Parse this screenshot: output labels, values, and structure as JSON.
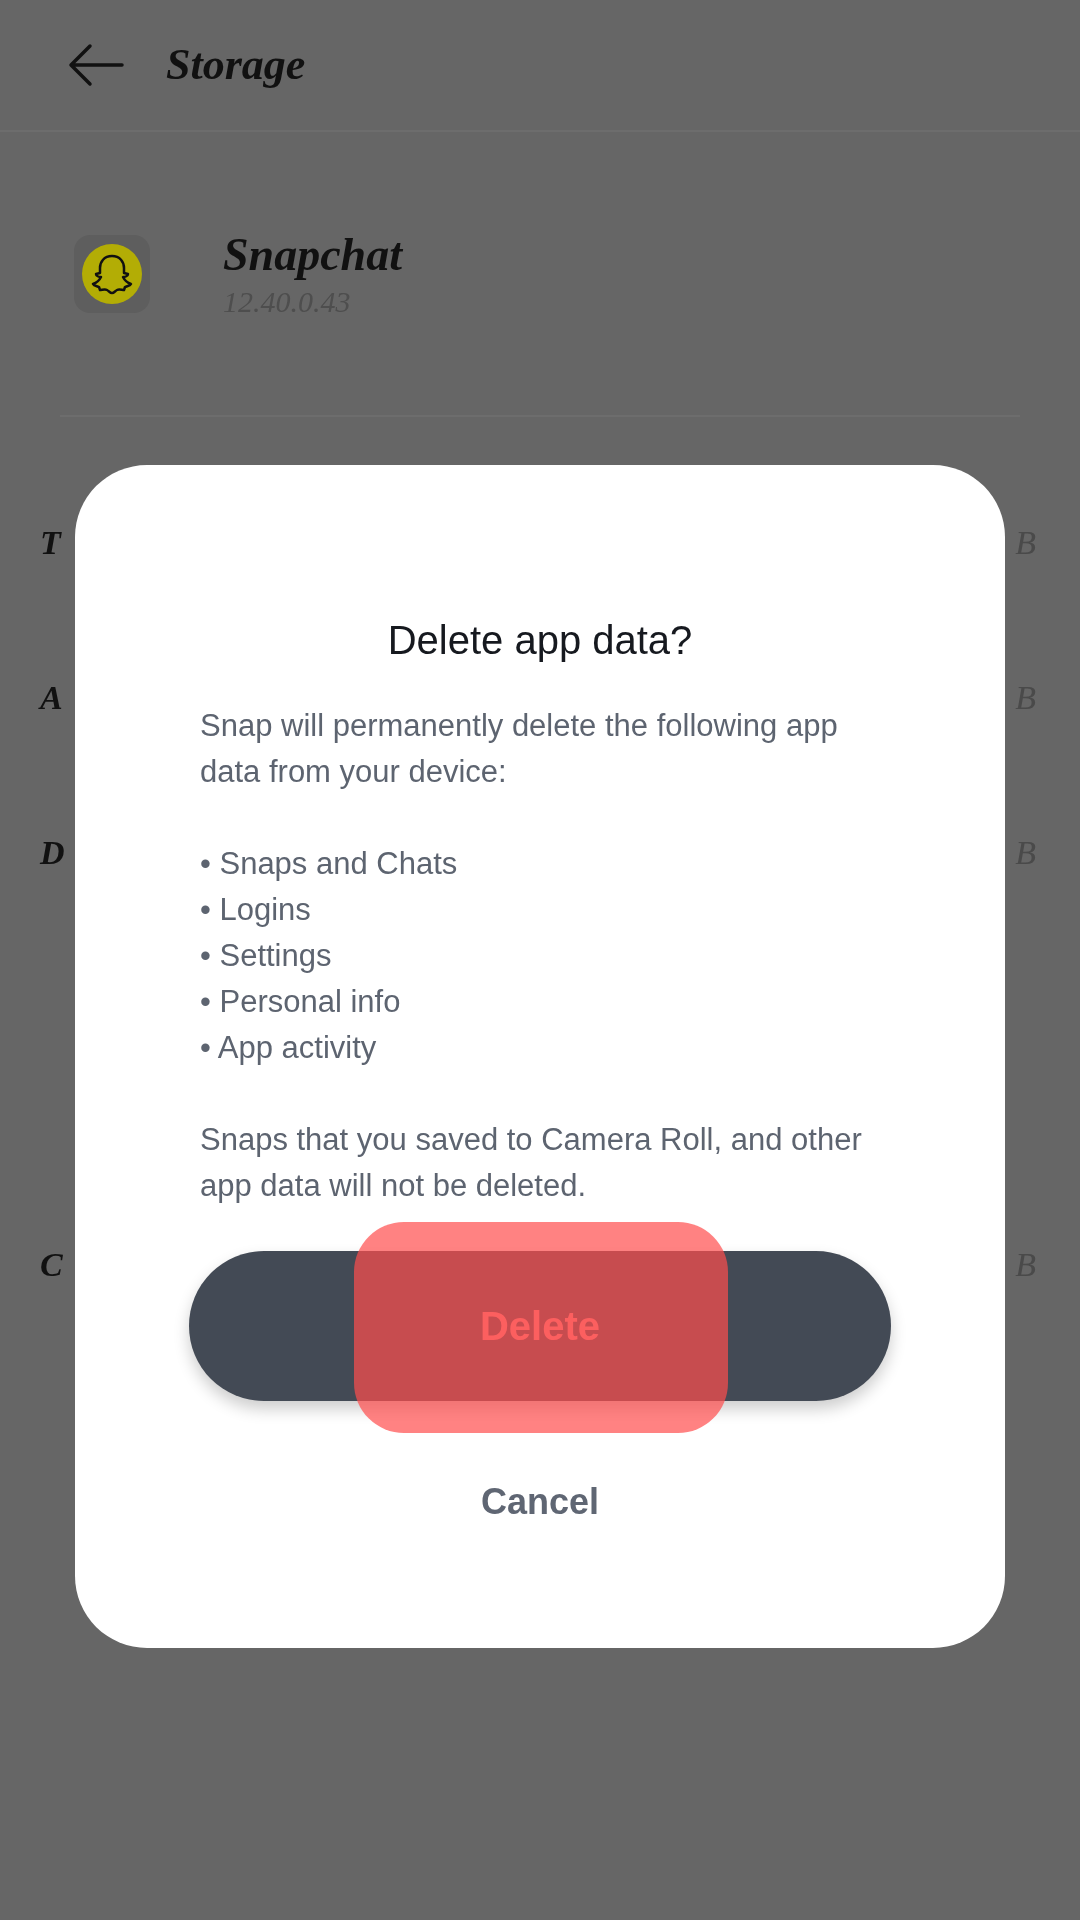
{
  "header": {
    "title": "Storage"
  },
  "app": {
    "name": "Snapchat",
    "version": "12.40.0.43"
  },
  "sections": [
    {
      "rows": [
        {
          "label": "T",
          "value": "B"
        },
        {
          "label": "A",
          "value": "B"
        },
        {
          "label": "D",
          "value": "B"
        }
      ]
    },
    {
      "rows": [
        {
          "label": "C",
          "value": "B"
        }
      ]
    }
  ],
  "dialog": {
    "title": "Delete app data?",
    "intro": "Snap will permanently delete the following app data from your device:",
    "items": [
      "• Snaps and Chats",
      "• Logins",
      "• Settings",
      "• Personal info",
      "• App activity"
    ],
    "note": "Snaps that you saved to Camera Roll, and other app data will not be deleted.",
    "buttons": [
      {
        "label": "Delete",
        "kind": "primary",
        "highlighted": true
      },
      {
        "label": "Cancel",
        "kind": "text",
        "highlighted": false
      }
    ]
  }
}
